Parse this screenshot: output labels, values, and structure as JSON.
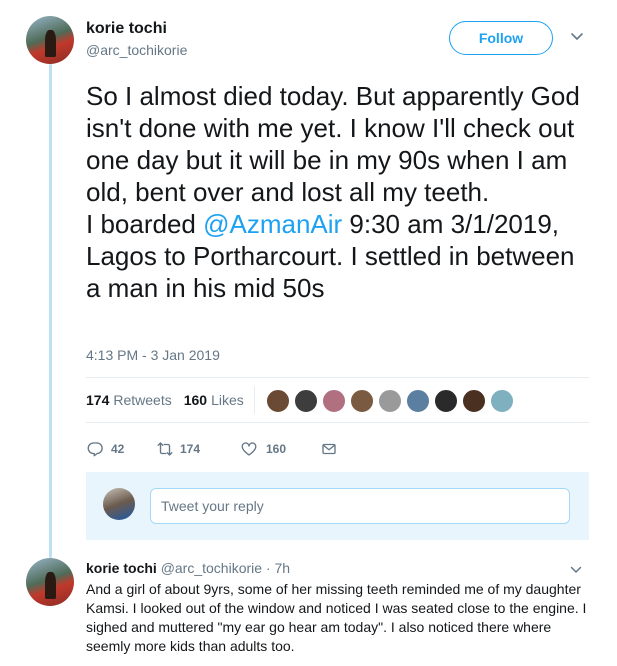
{
  "tweet": {
    "display_name": "korie tochi",
    "handle": "@arc_tochikorie",
    "follow_label": "Follow",
    "text_part1": "So I almost died today. But apparently God isn't done with me yet. I know I'll check out one day but it will be in my 90s when I am old, bent over and lost all my teeth.",
    "text_part2_prefix": "I boarded ",
    "mention": "@AzmanAir",
    "text_part2_suffix": " 9:30 am 3/1/2019, Lagos to Portharcourt. I settled in between a man in his mid 50s",
    "timestamp": "4:13 PM - 3 Jan 2019"
  },
  "stats": {
    "retweets_count": "174",
    "retweets_label": "Retweets",
    "likes_count": "160",
    "likes_label": "Likes",
    "liker_colors": [
      "#6b4a33",
      "#3d3d3d",
      "#b07080",
      "#7a5a40",
      "#9a9a9a",
      "#5a7fa0",
      "#2a2a2a",
      "#4a3020",
      "#7fb0c0"
    ]
  },
  "actions": {
    "reply_count": "42",
    "retweet_count": "174",
    "like_count": "160"
  },
  "reply_composer": {
    "placeholder": "Tweet your reply"
  },
  "reply": {
    "display_name": "korie tochi",
    "meta": "@arc_tochikorie · 7h",
    "text": "And a girl of about 9yrs, some of her missing teeth reminded me of my daughter Kamsi. I looked out of the window and noticed I was seated close to the engine. I sighed and muttered \"my ear go hear am today\". I also noticed there where seemly more kids than adults too."
  },
  "colors": {
    "accent": "#1da1f2",
    "muted": "#657786",
    "thread_line": "#bde0f5"
  }
}
